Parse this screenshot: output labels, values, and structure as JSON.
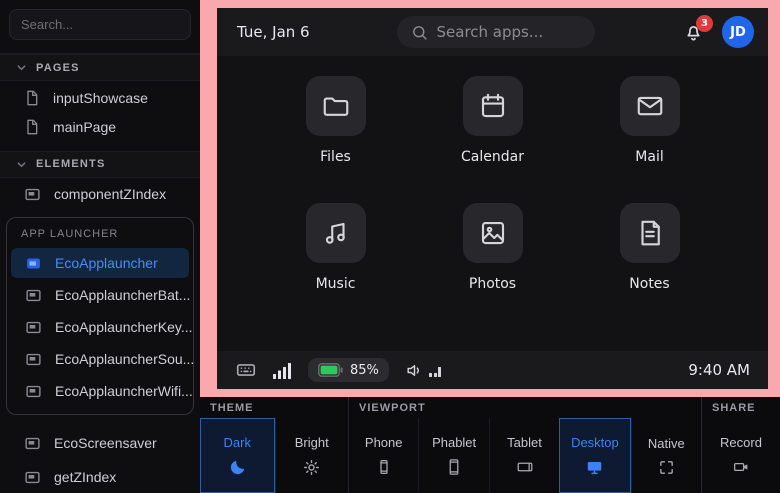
{
  "sidebar": {
    "search_placeholder": "Search...",
    "sections": [
      {
        "label": "PAGES",
        "items": [
          "inputShowcase",
          "mainPage"
        ]
      },
      {
        "label": "ELEMENTS",
        "items": [
          "componentZIndex"
        ]
      }
    ],
    "group": {
      "label": "APP LAUNCHER",
      "selected_item": "EcoApplauncher",
      "items": [
        "EcoApplauncher",
        "EcoApplauncherBat...",
        "EcoApplauncherKey...",
        "EcoApplauncherSou...",
        "EcoApplauncherWifi..."
      ]
    },
    "bottom_items": [
      "EcoScreensaver",
      "getZIndex"
    ]
  },
  "preview": {
    "topbar": {
      "date": "Tue, Jan 6",
      "search_placeholder": "Search apps...",
      "notification_count": "3",
      "avatar_initials": "JD"
    },
    "apps": [
      {
        "name": "Files",
        "icon": "folder-icon"
      },
      {
        "name": "Calendar",
        "icon": "calendar-icon"
      },
      {
        "name": "Mail",
        "icon": "mail-icon"
      },
      {
        "name": "Music",
        "icon": "music-icon"
      },
      {
        "name": "Photos",
        "icon": "photos-icon"
      },
      {
        "name": "Notes",
        "icon": "notes-icon"
      }
    ],
    "statusbar": {
      "battery_percent": "85%",
      "time": "9:40 AM"
    }
  },
  "toolbar": {
    "sections": [
      {
        "label": "THEME",
        "buttons": [
          {
            "label": "Dark",
            "icon": "moon-icon",
            "selected": true
          },
          {
            "label": "Bright",
            "icon": "sun-icon",
            "selected": false
          }
        ]
      },
      {
        "label": "VIEWPORT",
        "buttons": [
          {
            "label": "Phone",
            "icon": "phone-icon",
            "selected": false
          },
          {
            "label": "Phablet",
            "icon": "phablet-icon",
            "selected": false
          },
          {
            "label": "Tablet",
            "icon": "tablet-icon",
            "selected": false
          },
          {
            "label": "Desktop",
            "icon": "desktop-icon",
            "selected": true
          },
          {
            "label": "Native",
            "icon": "native-icon",
            "selected": false
          }
        ]
      },
      {
        "label": "SHARE",
        "buttons": [
          {
            "label": "Record",
            "icon": "record-icon",
            "selected": false
          }
        ]
      }
    ]
  },
  "colors": {
    "accent_blue": "#3b82f6",
    "frame_pink": "#f9a8ad",
    "battery_green": "#32c95c",
    "badge_red": "#e03a3a",
    "avatar_blue": "#2166e8"
  }
}
